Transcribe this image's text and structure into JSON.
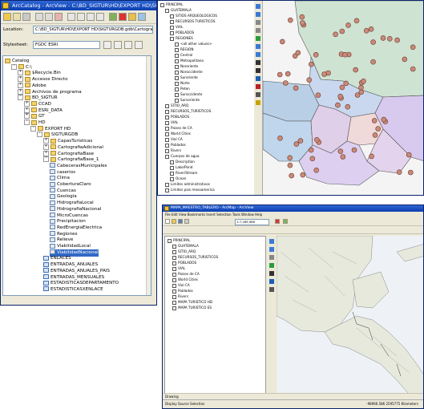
{
  "catalog": {
    "title": "ArcCatalog - ArcView - C:\\BD_SIGTUR\\HD\\EXPORT HD\\SIGTURGDB.gdb\\CartografiaBase 1\\ViabilidadNacional",
    "location_label": "Location:",
    "location_value": "C:\\BD_SIGTUR\\HD\\EXPORT HD\\SIGTURGDB.gdb\\CartografiaBa",
    "stylesheet_label": "Stylesheet:",
    "stylesheet_value": "FGDC ESRI",
    "tree": [
      {
        "label": "Catalog",
        "indent": 0,
        "icon": "catalog",
        "exp": ""
      },
      {
        "label": "C:\\",
        "indent": 1,
        "icon": "drive",
        "exp": "-"
      },
      {
        "label": "$Recycle.Bin",
        "indent": 2,
        "icon": "folder",
        "exp": "+"
      },
      {
        "label": "Accesos Directo",
        "indent": 2,
        "icon": "folder",
        "exp": "+"
      },
      {
        "label": "Adobe",
        "indent": 2,
        "icon": "folder",
        "exp": "+"
      },
      {
        "label": "Archivos de programa",
        "indent": 2,
        "icon": "folder",
        "exp": "+"
      },
      {
        "label": "BD_SIGTUR",
        "indent": 2,
        "icon": "folder",
        "exp": "-"
      },
      {
        "label": "CCAD",
        "indent": 3,
        "icon": "folder",
        "exp": "+"
      },
      {
        "label": "ESRI_DATA",
        "indent": 3,
        "icon": "folder",
        "exp": "+"
      },
      {
        "label": "GT",
        "indent": 3,
        "icon": "folder",
        "exp": "+"
      },
      {
        "label": "HD",
        "indent": 3,
        "icon": "folder",
        "exp": "-"
      },
      {
        "label": "EXPORT HD",
        "indent": 4,
        "icon": "folder",
        "exp": "-"
      },
      {
        "label": "SIGTURGDB",
        "indent": 5,
        "icon": "gdb",
        "exp": "-"
      },
      {
        "label": "CapasTuristicas",
        "indent": 6,
        "icon": "fds",
        "exp": "+"
      },
      {
        "label": "CartografiaAdicional",
        "indent": 6,
        "icon": "fds",
        "exp": "+"
      },
      {
        "label": "CartografiaBase",
        "indent": 6,
        "icon": "fds",
        "exp": "+"
      },
      {
        "label": "CartografiaBase_1",
        "indent": 6,
        "icon": "fds",
        "exp": "-"
      },
      {
        "label": "CabecerasMunicipales",
        "indent": 7,
        "icon": "fc",
        "exp": ""
      },
      {
        "label": "caserios",
        "indent": 7,
        "icon": "fc",
        "exp": ""
      },
      {
        "label": "Clima",
        "indent": 7,
        "icon": "fc",
        "exp": ""
      },
      {
        "label": "CoberturaClaro",
        "indent": 7,
        "icon": "fc",
        "exp": ""
      },
      {
        "label": "Cuencas",
        "indent": 7,
        "icon": "fc",
        "exp": ""
      },
      {
        "label": "Geologia",
        "indent": 7,
        "icon": "fc",
        "exp": ""
      },
      {
        "label": "HidrografiaLocal",
        "indent": 7,
        "icon": "fc",
        "exp": ""
      },
      {
        "label": "HidrografiaNacional",
        "indent": 7,
        "icon": "fc",
        "exp": ""
      },
      {
        "label": "MicroCuencas",
        "indent": 7,
        "icon": "fc",
        "exp": ""
      },
      {
        "label": "Precipitacion",
        "indent": 7,
        "icon": "fc",
        "exp": ""
      },
      {
        "label": "RedEnergiaElectrica",
        "indent": 7,
        "icon": "fc",
        "exp": ""
      },
      {
        "label": "Regiones",
        "indent": 7,
        "icon": "fc",
        "exp": ""
      },
      {
        "label": "Relieve",
        "indent": 7,
        "icon": "fc",
        "exp": ""
      },
      {
        "label": "ViabilidadLocal",
        "indent": 7,
        "icon": "fc",
        "exp": ""
      },
      {
        "label": "ViabilidadNacional",
        "indent": 7,
        "icon": "fc",
        "exp": "",
        "selected": true
      },
      {
        "label": "ENLACES",
        "indent": 6,
        "icon": "tbl",
        "exp": ""
      },
      {
        "label": "ENTRADAS_ANUALES",
        "indent": 6,
        "icon": "tbl",
        "exp": ""
      },
      {
        "label": "ENTRADAS_ANUALES_PAIS",
        "indent": 6,
        "icon": "tbl",
        "exp": ""
      },
      {
        "label": "ENTRADAS_MENSUALES",
        "indent": 6,
        "icon": "tbl",
        "exp": ""
      },
      {
        "label": "ESTADISTICASDEPARTAMENTO",
        "indent": 6,
        "icon": "tbl",
        "exp": ""
      },
      {
        "label": "ESTADISTICASXENLACE",
        "indent": 6,
        "icon": "tbl",
        "exp": ""
      }
    ]
  },
  "arcmap1": {
    "toc": [
      {
        "label": "PRINCIPAL",
        "indent": 0
      },
      {
        "label": "GUATEMALA",
        "indent": 1
      },
      {
        "label": "SITIOS ARQUEOLOGICOS",
        "indent": 2
      },
      {
        "label": "RECURSOS TURISTICOS",
        "indent": 2
      },
      {
        "label": "VIAL",
        "indent": 2
      },
      {
        "label": "POBLADOS",
        "indent": 2
      },
      {
        "label": "REGIONES",
        "indent": 2
      },
      {
        "label": "<all other values>",
        "indent": 3
      },
      {
        "label": "REGION",
        "indent": 3
      },
      {
        "label": "Central",
        "indent": 3
      },
      {
        "label": "Metropolitana",
        "indent": 3
      },
      {
        "label": "Nororiente",
        "indent": 3
      },
      {
        "label": "Noroccidente",
        "indent": 3
      },
      {
        "label": "Suroriente",
        "indent": 3
      },
      {
        "label": "Norte",
        "indent": 3
      },
      {
        "label": "Peten",
        "indent": 3
      },
      {
        "label": "Suroccidente",
        "indent": 3
      },
      {
        "label": "Sursoriente",
        "indent": 3
      },
      {
        "label": "SITIO_ARQ",
        "indent": 1
      },
      {
        "label": "RECURSOS_TURISTICOS",
        "indent": 1
      },
      {
        "label": "POBLADOS",
        "indent": 1
      },
      {
        "label": "VIAL",
        "indent": 1
      },
      {
        "label": "Paises de CA",
        "indent": 1
      },
      {
        "label": "World Cities",
        "indent": 1
      },
      {
        "label": "Vial CA",
        "indent": 1
      },
      {
        "label": "Poblados",
        "indent": 1
      },
      {
        "label": "Rivers",
        "indent": 1
      },
      {
        "label": "Cuerpos de agua",
        "indent": 1
      },
      {
        "label": "Description",
        "indent": 2
      },
      {
        "label": "Lake/Pond",
        "indent": 2
      },
      {
        "label": "River/Stream",
        "indent": 2
      },
      {
        "label": "Ocean",
        "indent": 2
      },
      {
        "label": "Limites administrativos",
        "indent": 1
      },
      {
        "label": "Limites pais mesoamerica",
        "indent": 1
      }
    ]
  },
  "arcmap2": {
    "title": "MAPA_MAESTRO_TABLERO - ArcMap - ArcView",
    "menu": "File  Edit  View  Bookmarks  Insert  Selection  Tools  Window  Help",
    "scale": "1:7,289,988",
    "toc": [
      {
        "label": "PRINCIPAL",
        "indent": 0
      },
      {
        "label": "GUATEMALA",
        "indent": 1
      },
      {
        "label": "SITIO_ARQ",
        "indent": 1
      },
      {
        "label": "RECURSOS_TURISTICOS",
        "indent": 1
      },
      {
        "label": "POBLADOS",
        "indent": 1
      },
      {
        "label": "VIAL",
        "indent": 1
      },
      {
        "label": "Paises de CA",
        "indent": 1
      },
      {
        "label": "World Cities",
        "indent": 1
      },
      {
        "label": "Vial CA",
        "indent": 1
      },
      {
        "label": "Poblados",
        "indent": 1
      },
      {
        "label": "Rivers",
        "indent": 1
      },
      {
        "label": "MAPA TURISTICO HD",
        "indent": 1
      },
      {
        "label": "MAPA TURISTICO ES",
        "indent": 1
      }
    ],
    "tabs": "Display  Source  Selection",
    "drawing": "Drawing",
    "status_coords": "-98966.586  2595775 Kilometers"
  },
  "colors": {
    "title_bar": "#0a3fb0",
    "selection": "#316ac5",
    "water": "#eef2f7",
    "land": "#e8ecd9"
  }
}
